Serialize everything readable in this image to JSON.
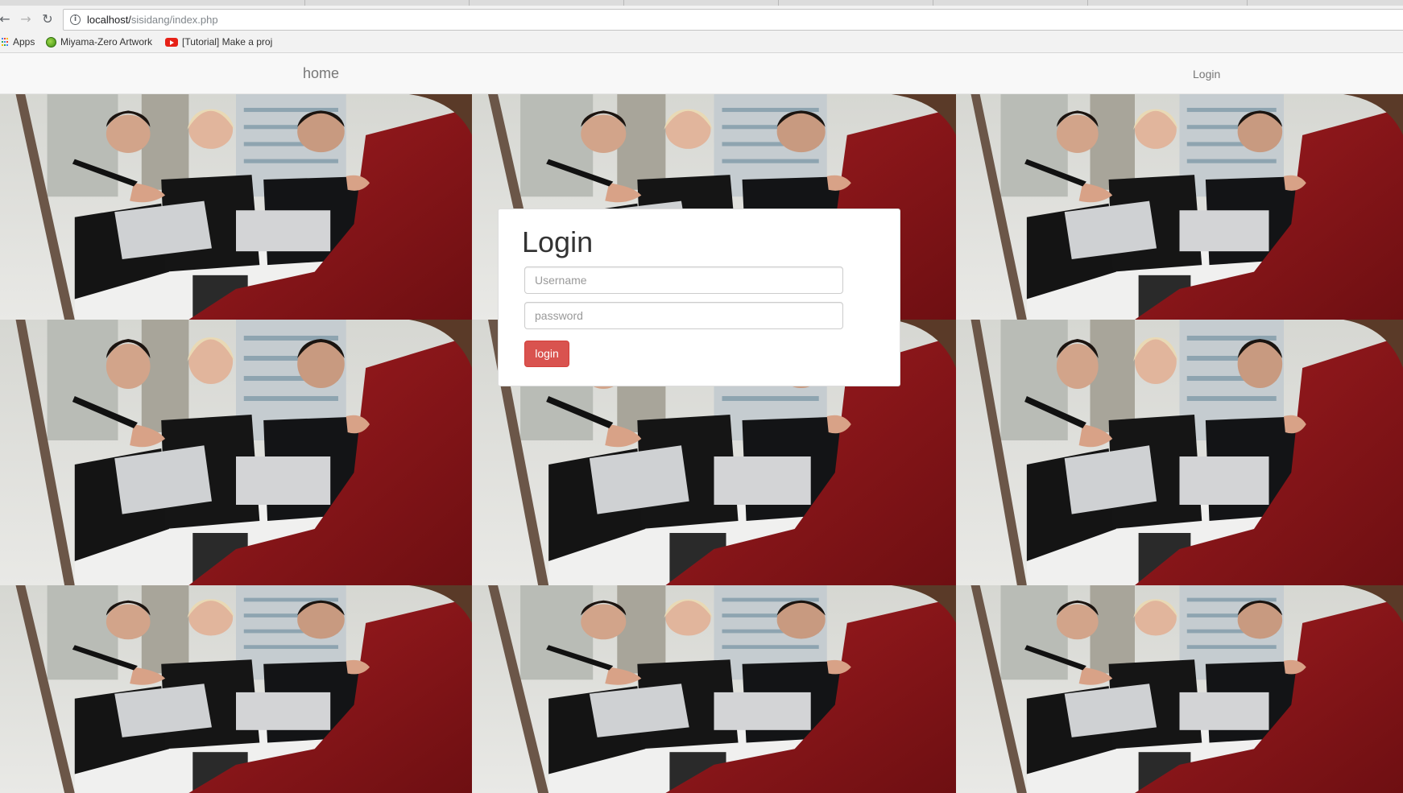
{
  "browser": {
    "url_host": "localhost/",
    "url_path": "sisidang/index.php",
    "bookmarks": [
      {
        "label": "Apps",
        "icon": "apps-grid-icon"
      },
      {
        "label": "Miyama-Zero Artwork",
        "icon": "green-orb-icon"
      },
      {
        "label": "[Tutorial] Make a proj",
        "icon": "youtube-icon"
      }
    ]
  },
  "navbar": {
    "brand": "home",
    "login_link": "Login"
  },
  "login_form": {
    "title": "Login",
    "username_placeholder": "Username",
    "password_placeholder": "password",
    "submit_label": "login"
  },
  "colors": {
    "button_danger": "#d9534f",
    "navbar_bg": "#f8f8f8",
    "jacket_red": "#8e1418"
  }
}
